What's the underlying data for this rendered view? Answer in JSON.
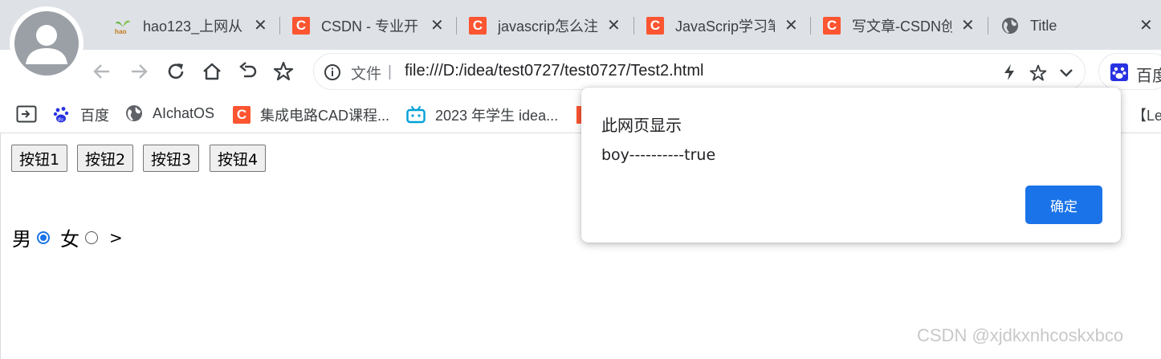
{
  "browser": {
    "tabs": [
      {
        "title": "hao123_上网从",
        "icon": "hao123-icon"
      },
      {
        "title": "CSDN - 专业开",
        "icon": "csdn-icon"
      },
      {
        "title": "javascrip怎么注",
        "icon": "csdn-icon"
      },
      {
        "title": "JavaScrip学习笔",
        "icon": "csdn-icon"
      },
      {
        "title": "写文章-CSDN创",
        "icon": "csdn-icon"
      },
      {
        "title": "Title",
        "icon": "globe-icon"
      }
    ],
    "tab_close_glyph": "✕",
    "csdn_glyph": "C",
    "address": {
      "label": "文件",
      "divider": "|",
      "url": "file:///D:/idea/test0727/test0727/Test2.html"
    },
    "extension_label": "百度",
    "bookmarks": [
      {
        "label": "百度",
        "icon": "baidu-paw-icon"
      },
      {
        "label": "AIchatOS",
        "icon": "globe-icon"
      },
      {
        "label": "集成电路CAD课程...",
        "icon": "csdn-icon"
      },
      {
        "label": "2023 年学生 idea...",
        "icon": "bilibili-icon"
      }
    ],
    "bookmark_overflow": "【Le"
  },
  "page": {
    "buttons": [
      "按钮1",
      "按钮2",
      "按钮3",
      "按钮4"
    ],
    "radio_male_label": "男",
    "radio_female_label": "女",
    "radio_male_checked": true,
    "radio_female_checked": false,
    "trailing_text": ">"
  },
  "dialog": {
    "title": "此网页显示",
    "message": "boy----------true",
    "ok_label": "确定"
  },
  "watermark": "CSDN @xjdkxnhcoskxbco",
  "colors": {
    "accent": "#1a73e8",
    "csdn": "#fc5531",
    "tabstrip": "#dee1e6"
  }
}
